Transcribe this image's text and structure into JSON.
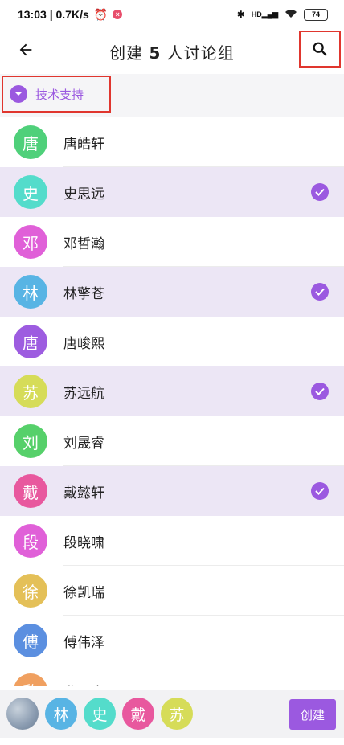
{
  "status_bar": {
    "time_speed": "13:03 | 0.7K/s",
    "alarm_icon": "alarm-icon",
    "notify_badge": "×",
    "signal_text": "HD",
    "battery": "74"
  },
  "header": {
    "title_prefix": "创建 ",
    "title_count": "5",
    "title_suffix": " 人讨论组"
  },
  "group": {
    "label": "技术支持"
  },
  "contacts": [
    {
      "char": "唐",
      "name": "唐皓轩",
      "color": "#4fd07a",
      "selected": false
    },
    {
      "char": "史",
      "name": "史思远",
      "color": "#54dccb",
      "selected": true
    },
    {
      "char": "邓",
      "name": "邓哲瀚",
      "color": "#e060d8",
      "selected": false
    },
    {
      "char": "林",
      "name": "林擎苍",
      "color": "#58b4e4",
      "selected": true
    },
    {
      "char": "唐",
      "name": "唐峻熙",
      "color": "#9d5ce0",
      "selected": false
    },
    {
      "char": "苏",
      "name": "苏远航",
      "color": "#d6dc58",
      "selected": true
    },
    {
      "char": "刘",
      "name": "刘晟睿",
      "color": "#56d06a",
      "selected": false
    },
    {
      "char": "戴",
      "name": "戴懿轩",
      "color": "#e8589e",
      "selected": true
    },
    {
      "char": "段",
      "name": "段晓啸",
      "color": "#e060d8",
      "selected": false
    },
    {
      "char": "徐",
      "name": "徐凯瑞",
      "color": "#e4c058",
      "selected": false
    },
    {
      "char": "傅",
      "name": "傅伟泽",
      "color": "#5b8fe0",
      "selected": false
    },
    {
      "char": "黎",
      "name": "黎明杰",
      "color": "#f0a060",
      "selected": false
    }
  ],
  "picked": [
    {
      "char": "林",
      "color": "#58b4e4"
    },
    {
      "char": "史",
      "color": "#54dccb"
    },
    {
      "char": "戴",
      "color": "#e8589e"
    },
    {
      "char": "苏",
      "color": "#d6dc58"
    }
  ],
  "bottom": {
    "create_label": "创建"
  },
  "colors": {
    "accent": "#9b59e0",
    "selected_row": "#ece6f5",
    "highlight_box": "#e0362e"
  }
}
